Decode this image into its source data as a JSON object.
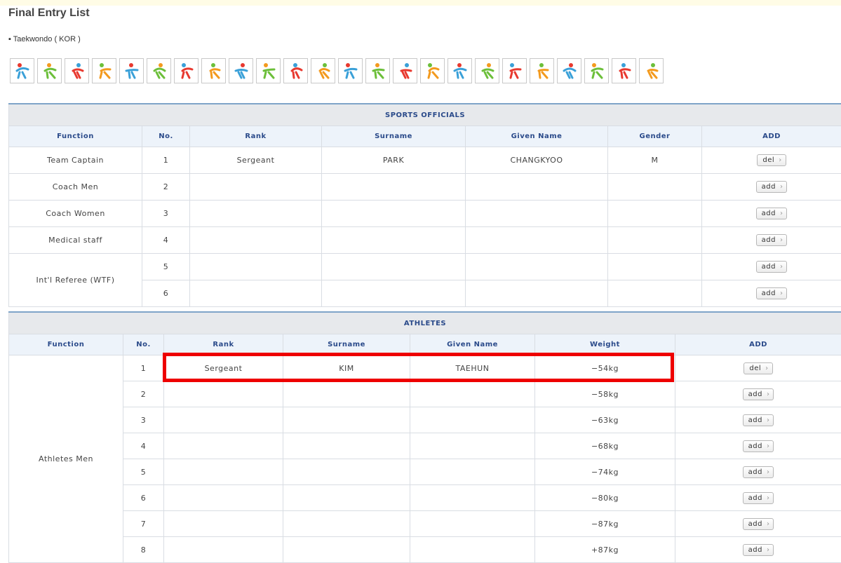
{
  "page": {
    "title": "Final Entry List",
    "subtitle": "▪ Taekwondo ( KOR )"
  },
  "sport_icons": [
    "fencing-icon",
    "boxing-icon",
    "gymnastics-icon",
    "dance-icon",
    "cycling-icon",
    "athletics-icon",
    "swimming-icon",
    "shooting-icon",
    "diving-icon",
    "judo-icon",
    "rowing-icon",
    "fencing-pair-icon",
    "wrestling-icon",
    "sailing-icon",
    "tennis-icon",
    "badminton-icon",
    "weightlifting-icon",
    "kayak-icon",
    "rowing2-icon",
    "running-icon",
    "handball-icon",
    "relay-icon",
    "hockey-icon",
    "taekwondo-icon"
  ],
  "officials": {
    "section_title": "SPORTS OFFICIALS",
    "columns": [
      "Function",
      "No.",
      "Rank",
      "Surname",
      "Given Name",
      "Gender",
      "ADD"
    ],
    "rows": [
      {
        "function": "Team Captain",
        "no": "1",
        "rank": "Sergeant",
        "surname": "PARK",
        "given": "CHANGKYOO",
        "gender": "M",
        "action": "del"
      },
      {
        "function": "Coach Men",
        "no": "2",
        "rank": "",
        "surname": "",
        "given": "",
        "gender": "",
        "action": "add"
      },
      {
        "function": "Coach Women",
        "no": "3",
        "rank": "",
        "surname": "",
        "given": "",
        "gender": "",
        "action": "add"
      },
      {
        "function": "Medical staff",
        "no": "4",
        "rank": "",
        "surname": "",
        "given": "",
        "gender": "",
        "action": "add"
      },
      {
        "function": "Int'l Referee (WTF)",
        "no": "5",
        "rank": "",
        "surname": "",
        "given": "",
        "gender": "",
        "action": "add"
      },
      {
        "function": "",
        "no": "6",
        "rank": "",
        "surname": "",
        "given": "",
        "gender": "",
        "action": "add"
      }
    ]
  },
  "athletes": {
    "section_title": "ATHLETES",
    "columns": [
      "Function",
      "No.",
      "Rank",
      "Surname",
      "Given Name",
      "Weight",
      "ADD"
    ],
    "function_label": "Athletes Men",
    "rows": [
      {
        "no": "1",
        "rank": "Sergeant",
        "surname": "KIM",
        "given": "TAEHUN",
        "weight": "−54kg",
        "action": "del"
      },
      {
        "no": "2",
        "rank": "",
        "surname": "",
        "given": "",
        "weight": "−58kg",
        "action": "add"
      },
      {
        "no": "3",
        "rank": "",
        "surname": "",
        "given": "",
        "weight": "−63kg",
        "action": "add"
      },
      {
        "no": "4",
        "rank": "",
        "surname": "",
        "given": "",
        "weight": "−68kg",
        "action": "add"
      },
      {
        "no": "5",
        "rank": "",
        "surname": "",
        "given": "",
        "weight": "−74kg",
        "action": "add"
      },
      {
        "no": "6",
        "rank": "",
        "surname": "",
        "given": "",
        "weight": "−80kg",
        "action": "add"
      },
      {
        "no": "7",
        "rank": "",
        "surname": "",
        "given": "",
        "weight": "−87kg",
        "action": "add"
      },
      {
        "no": "8",
        "rank": "",
        "surname": "",
        "given": "",
        "weight": "+87kg",
        "action": "add"
      }
    ]
  },
  "colors": {
    "highlight": "#ee0000",
    "header_text": "#2a4a8a",
    "section_bg": "#e7e9ec",
    "col_header_bg": "#edf3fa"
  }
}
